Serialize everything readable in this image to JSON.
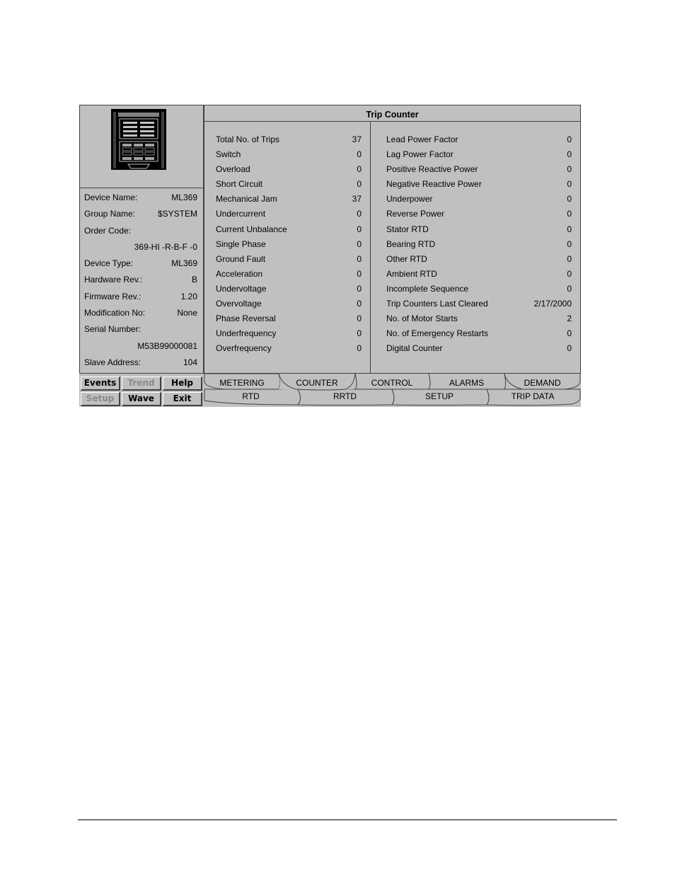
{
  "window": {
    "title": "Trip Counter"
  },
  "device_info": [
    {
      "label": "Device Name:",
      "value": "ML369"
    },
    {
      "label": "Group Name:",
      "value": "$SYSTEM"
    },
    {
      "label": "Order Code:",
      "value": ""
    },
    {
      "label": "",
      "value": "369-HI -R-B-F -0"
    },
    {
      "label": "Device Type:",
      "value": "ML369"
    },
    {
      "label": "Hardware Rev.:",
      "value": "B"
    },
    {
      "label": "Firmware Rev.:",
      "value": "1.20"
    },
    {
      "label": "Modification No:",
      "value": "None"
    },
    {
      "label": "Serial Number:",
      "value": ""
    },
    {
      "label": "",
      "value": "M53B99000081"
    },
    {
      "label": "Slave Address:",
      "value": "104"
    }
  ],
  "buttons": [
    {
      "label": "Events",
      "enabled": true
    },
    {
      "label": "Trend",
      "enabled": false
    },
    {
      "label": "Help",
      "enabled": true
    },
    {
      "label": "Setup",
      "enabled": false
    },
    {
      "label": "Wave",
      "enabled": true
    },
    {
      "label": "Exit",
      "enabled": true
    }
  ],
  "counters_left": [
    {
      "label": "Total No. of Trips",
      "value": "37"
    },
    {
      "label": "Switch",
      "value": "0"
    },
    {
      "label": "Overload",
      "value": "0"
    },
    {
      "label": "Short Circuit",
      "value": "0"
    },
    {
      "label": "Mechanical Jam",
      "value": "37"
    },
    {
      "label": "Undercurrent",
      "value": "0"
    },
    {
      "label": "Current Unbalance",
      "value": "0"
    },
    {
      "label": "Single Phase",
      "value": "0"
    },
    {
      "label": "Ground Fault",
      "value": "0"
    },
    {
      "label": "Acceleration",
      "value": "0"
    },
    {
      "label": "Undervoltage",
      "value": "0"
    },
    {
      "label": "Overvoltage",
      "value": "0"
    },
    {
      "label": "Phase Reversal",
      "value": "0"
    },
    {
      "label": "Underfrequency",
      "value": "0"
    },
    {
      "label": "Overfrequency",
      "value": "0"
    }
  ],
  "counters_right": [
    {
      "label": "Lead Power Factor",
      "value": "0"
    },
    {
      "label": "Lag Power Factor",
      "value": "0"
    },
    {
      "label": "Positive Reactive Power",
      "value": "0"
    },
    {
      "label": "Negative Reactive Power",
      "value": "0"
    },
    {
      "label": "Underpower",
      "value": "0"
    },
    {
      "label": "Reverse Power",
      "value": "0"
    },
    {
      "label": "Stator RTD",
      "value": "0"
    },
    {
      "label": "Bearing RTD",
      "value": "0"
    },
    {
      "label": "Other RTD",
      "value": "0"
    },
    {
      "label": "Ambient RTD",
      "value": "0"
    },
    {
      "label": "Incomplete Sequence",
      "value": "0"
    },
    {
      "label": "Trip Counters Last Cleared",
      "value": "2/17/2000"
    },
    {
      "label": "No. of Motor Starts",
      "value": "2"
    },
    {
      "label": "No. of Emergency Restarts",
      "value": "0"
    },
    {
      "label": "Digital Counter",
      "value": "0"
    }
  ],
  "tabs_top": [
    {
      "label": "METERING",
      "active": false
    },
    {
      "label": "COUNTER",
      "active": true
    },
    {
      "label": "CONTROL",
      "active": false
    },
    {
      "label": "ALARMS",
      "active": false
    },
    {
      "label": "DEMAND",
      "active": false
    }
  ],
  "tabs_bottom": [
    {
      "label": "RTD"
    },
    {
      "label": "RRTD"
    },
    {
      "label": "SETUP"
    },
    {
      "label": "TRIP DATA"
    }
  ],
  "icons": {
    "device": "relay-device-icon"
  }
}
